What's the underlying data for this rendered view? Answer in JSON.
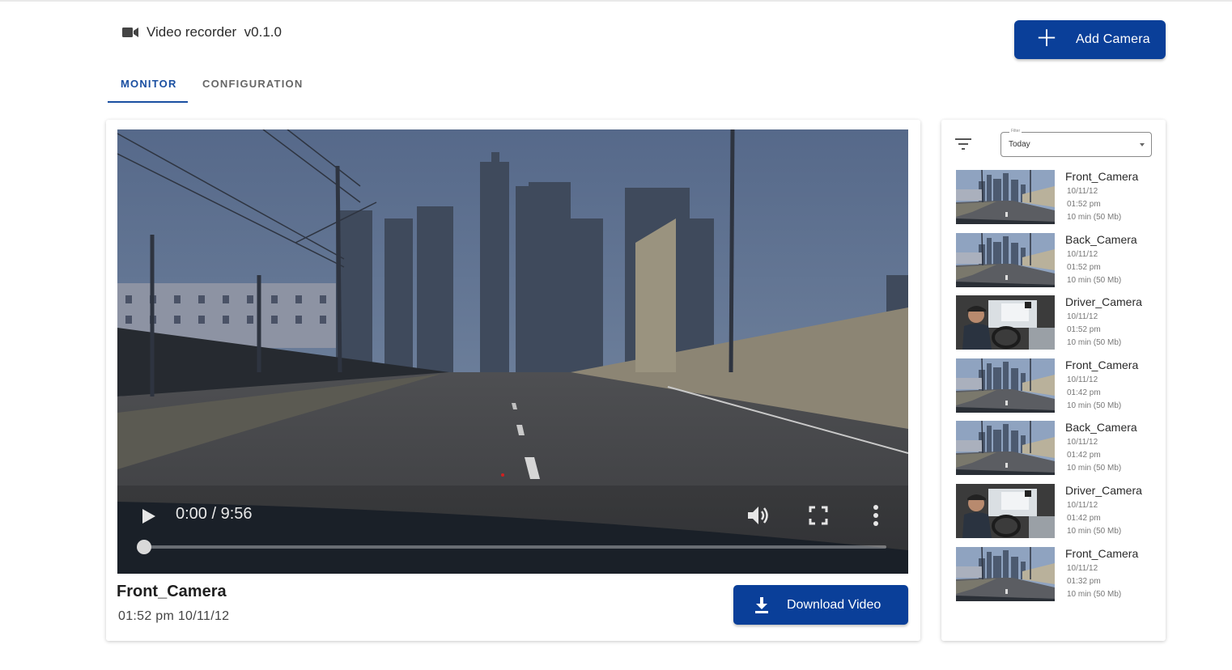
{
  "app": {
    "title": "Video recorder  v0.1.0",
    "icon": "videocam-icon"
  },
  "header": {
    "add_camera_label": "Add Camera",
    "accent_color": "#0a3f99"
  },
  "tabs": [
    {
      "label": "MONITOR",
      "active": true
    },
    {
      "label": "CONFIGURATION",
      "active": false
    }
  ],
  "player": {
    "time_display": "0:00 / 9:56",
    "progress": 0.0,
    "camera_name": "Front_Camera",
    "timestamp": "01:52 pm 10/11/12",
    "download_label": "Download Video"
  },
  "filter": {
    "label": "Filter",
    "value": "Today"
  },
  "recordings": [
    {
      "name": "Front_Camera",
      "date": "10/11/12",
      "time": "01:52 pm",
      "duration": "10 min (50 Mb)",
      "thumb": "road"
    },
    {
      "name": "Back_Camera",
      "date": "10/11/12",
      "time": "01:52 pm",
      "duration": "10 min (50 Mb)",
      "thumb": "road"
    },
    {
      "name": "Driver_Camera",
      "date": "10/11/12",
      "time": "01:52 pm",
      "duration": "10 min (50 Mb)",
      "thumb": "driver"
    },
    {
      "name": "Front_Camera",
      "date": "10/11/12",
      "time": "01:42 pm",
      "duration": "10 min (50 Mb)",
      "thumb": "road"
    },
    {
      "name": "Back_Camera",
      "date": "10/11/12",
      "time": "01:42 pm",
      "duration": "10 min (50 Mb)",
      "thumb": "road"
    },
    {
      "name": "Driver_Camera",
      "date": "10/11/12",
      "time": "01:42 pm",
      "duration": "10 min (50 Mb)",
      "thumb": "driver"
    },
    {
      "name": "Front_Camera",
      "date": "10/11/12",
      "time": "01:32 pm",
      "duration": "10 min (50 Mb)",
      "thumb": "road"
    }
  ]
}
